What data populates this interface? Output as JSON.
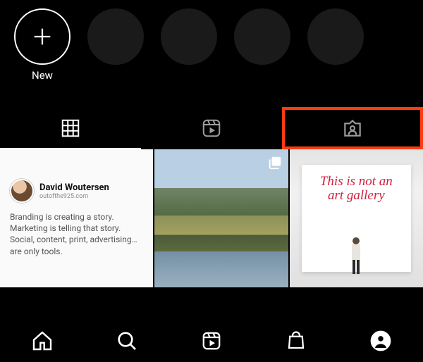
{
  "highlights": {
    "new_label": "New"
  },
  "tabs": {
    "grid_name": "posts-grid-tab",
    "reels_name": "reels-tab",
    "tagged_name": "tagged-tab"
  },
  "posts": {
    "p1": {
      "author_name": "David Woutersen",
      "author_handle": "outofthe925.com",
      "body": "Branding is creating a story. Marketing is telling that story. Social, content, print, advertising… are only tools."
    },
    "p3": {
      "line1": "This is not an",
      "line2": "art gallery"
    }
  },
  "nav": {
    "home": "home",
    "search": "search",
    "reels": "reels",
    "shop": "shop",
    "profile": "profile"
  }
}
